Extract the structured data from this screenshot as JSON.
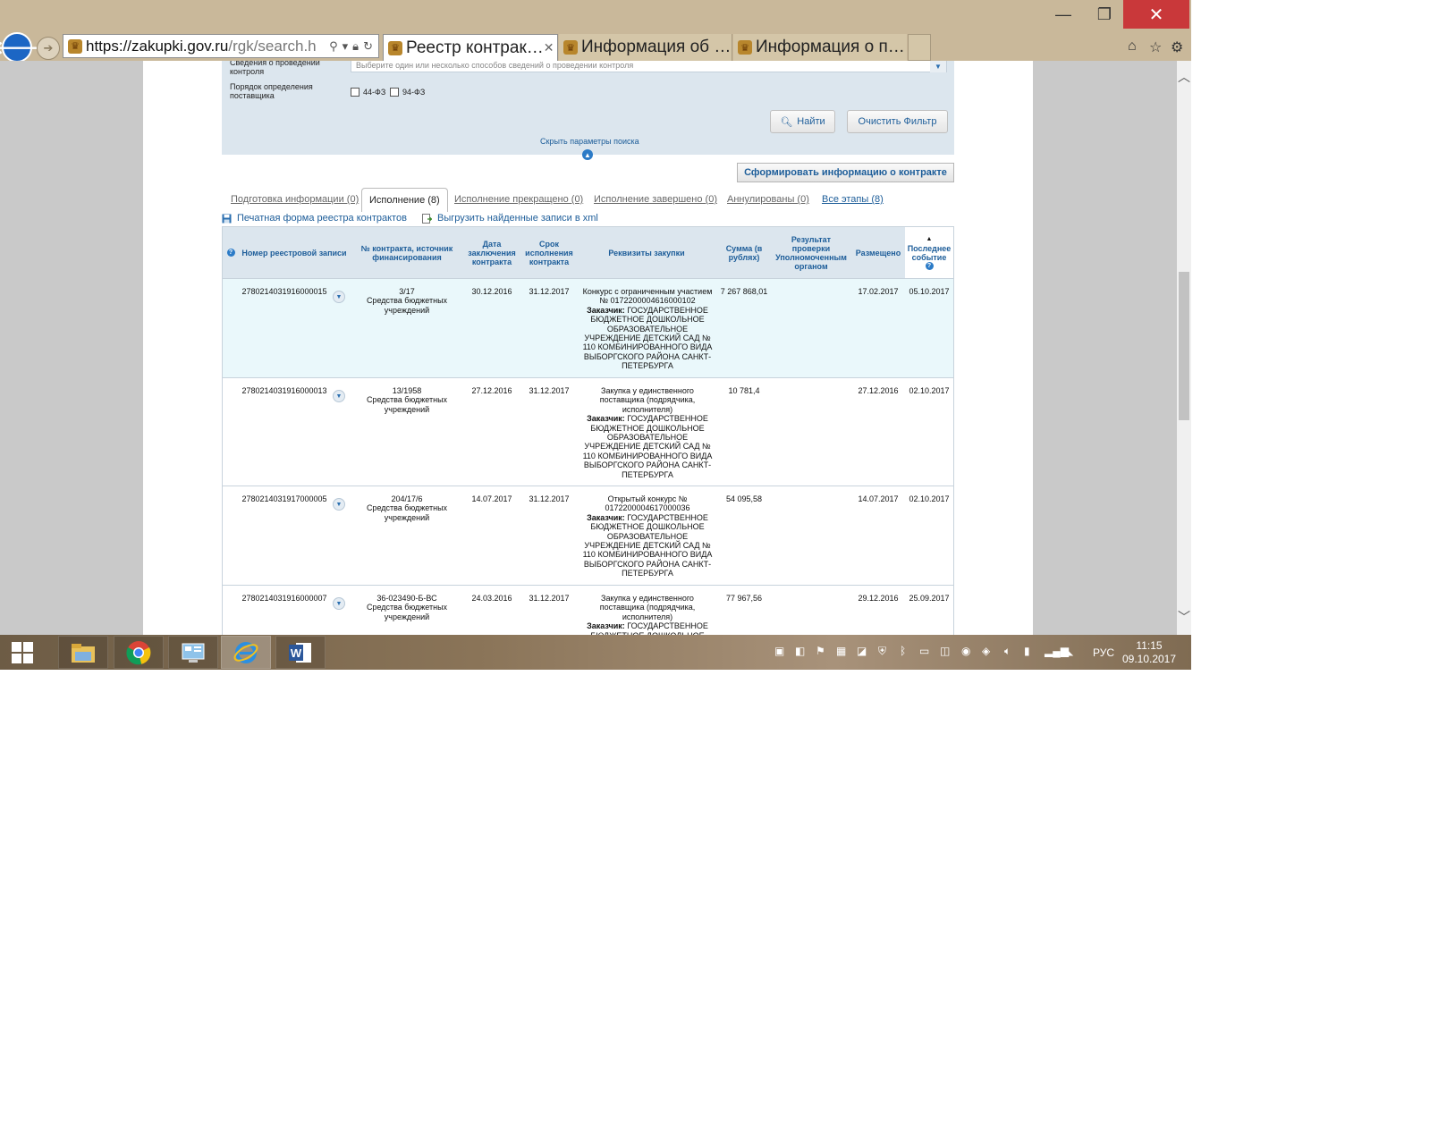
{
  "window": {
    "minimize": "—",
    "maximize": "❐",
    "close": "✕"
  },
  "browser": {
    "url_main": "https://zakupki.gov.ru",
    "url_rest": "/rgk/search.h",
    "tabs": [
      {
        "label": "Реестр контрак…",
        "active": true
      },
      {
        "label": "Информация об …",
        "active": false
      },
      {
        "label": "Информация о п…",
        "active": false
      }
    ]
  },
  "filter": {
    "control_label": "Сведения о проведении контроля",
    "control_placeholder": "Выберите один или несколько способов сведений о проведении контроля",
    "supplier_label": "Порядок определения поставщика",
    "cb_44": "44-ФЗ",
    "cb_94": "94-ФЗ",
    "find_button": "Найти",
    "clear_button": "Очистить Фильтр",
    "hide_params": "Скрыть параметры поиска"
  },
  "form_button": "Сформировать информацию о контракте",
  "stage_tabs": [
    "Подготовка информации (0)",
    "Исполнение (8)",
    "Исполнение прекращено (0)",
    "Исполнение завершено (0)",
    "Аннулированы (0)",
    "Все этапы (8)"
  ],
  "tools": {
    "print": "Печатная форма реестра контрактов",
    "export": "Выгрузить найденные записи в xml"
  },
  "table": {
    "headers": {
      "help": "?",
      "number": "Номер реестровой записи",
      "contract": "№ контракта, источник финансирования",
      "date": "Дата заключения контракта",
      "term": "Срок исполнения контракта",
      "requisites": "Реквизиты закупки",
      "sum": "Сумма (в рублях)",
      "check": "Результат проверки Уполномоченным органом",
      "placed": "Размещено",
      "last": "Последнее событие"
    },
    "rows": [
      {
        "number": "2780214031916000015",
        "contract": "3/17",
        "source": "Средства бюджетных учреждений",
        "date": "30.12.2016",
        "term": "31.12.2017",
        "proc": "Конкурс с ограниченным участием № 0172200004616000102",
        "customer_label": "Заказчик:",
        "customer": "ГОСУДАРСТВЕННОЕ БЮДЖЕТНОЕ ДОШКОЛЬНОЕ ОБРАЗОВАТЕЛЬНОЕ УЧРЕЖДЕНИЕ ДЕТСКИЙ САД № 110 КОМБИНИРОВАННОГО ВИДА ВЫБОРГСКОГО РАЙОНА САНКТ-ПЕТЕРБУРГА",
        "sum": "7 267 868,01",
        "placed": "17.02.2017",
        "last": "05.10.2017"
      },
      {
        "number": "2780214031916000013",
        "contract": "13/1958",
        "source": "Средства бюджетных учреждений",
        "date": "27.12.2016",
        "term": "31.12.2017",
        "proc": "Закупка у единственного поставщика (подрядчика, исполнителя)",
        "customer_label": "Заказчик:",
        "customer": "ГОСУДАРСТВЕННОЕ БЮДЖЕТНОЕ ДОШКОЛЬНОЕ ОБРАЗОВАТЕЛЬНОЕ УЧРЕЖДЕНИЕ ДЕТСКИЙ САД № 110 КОМБИНИРОВАННОГО ВИДА ВЫБОРГСКОГО РАЙОНА САНКТ-ПЕТЕРБУРГА",
        "sum": "10 781,4",
        "placed": "27.12.2016",
        "last": "02.10.2017"
      },
      {
        "number": "2780214031917000005",
        "contract": "204/17/6",
        "source": "Средства бюджетных учреждений",
        "date": "14.07.2017",
        "term": "31.12.2017",
        "proc": "Открытый конкурс № 0172200004617000036",
        "customer_label": "Заказчик:",
        "customer": "ГОСУДАРСТВЕННОЕ БЮДЖЕТНОЕ ДОШКОЛЬНОЕ ОБРАЗОВАТЕЛЬНОЕ УЧРЕЖДЕНИЕ ДЕТСКИЙ САД № 110 КОМБИНИРОВАННОГО ВИДА ВЫБОРГСКОГО РАЙОНА САНКТ-ПЕТЕРБУРГА",
        "sum": "54 095,58",
        "placed": "14.07.2017",
        "last": "02.10.2017"
      },
      {
        "number": "2780214031916000007",
        "contract": "36-023490-Б-ВС",
        "source": "Средства бюджетных учреждений",
        "date": "24.03.2016",
        "term": "31.12.2017",
        "proc": "Закупка у единственного поставщика (подрядчика, исполнителя)",
        "customer_label": "Заказчик:",
        "customer": "ГОСУДАРСТВЕННОЕ БЮДЖЕТНОЕ ДОШКОЛЬНОЕ",
        "sum": "77 967,56",
        "placed": "29.12.2016",
        "last": "25.09.2017"
      }
    ]
  },
  "taskbar": {
    "lang": "РУС",
    "time": "11:15",
    "date": "09.10.2017"
  }
}
